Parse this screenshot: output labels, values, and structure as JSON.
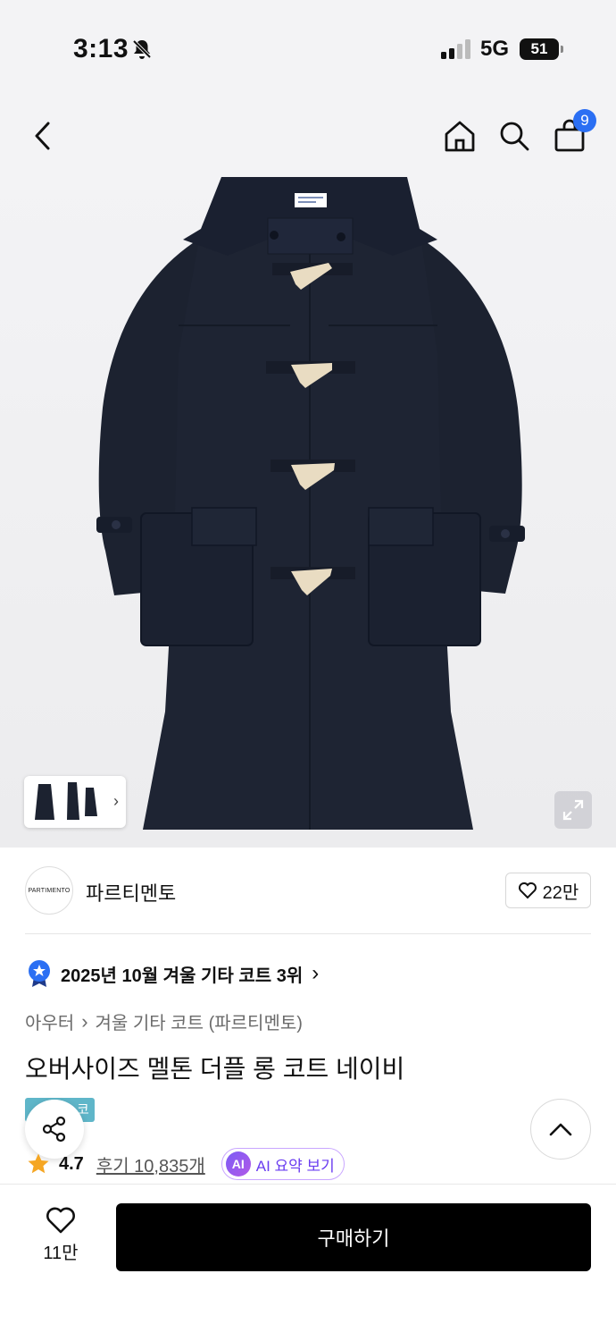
{
  "status_bar": {
    "time": "3:13",
    "network": "5G",
    "battery": "51"
  },
  "nav": {
    "cart_count": "9"
  },
  "brand": {
    "logo_text": "PARTIMENTO",
    "name": "파르티멘토",
    "likes": "22만"
  },
  "ranking": {
    "text": "2025년 10월 겨울 기타 코트 3위"
  },
  "breadcrumb": {
    "category": "아우터",
    "subcategory": "겨울 기타 코트 (파르티멘토)"
  },
  "product": {
    "title": "오버사이즈 멜톤 더플 롱 코트 네이비",
    "tag": "코"
  },
  "rating": {
    "score": "4.7",
    "reviews": "후기 10,835개"
  },
  "ai": {
    "badge": "AI",
    "label": "AI 요약 보기"
  },
  "bottom": {
    "wish_count": "11만",
    "buy_label": "구매하기"
  },
  "colors": {
    "accent": "#2b6ff3",
    "coat": "#1c2230",
    "toggle": "#e9dcc2",
    "tag": "#5fb6c9",
    "ai": "#7b5cf5",
    "star": "#f5a623"
  }
}
